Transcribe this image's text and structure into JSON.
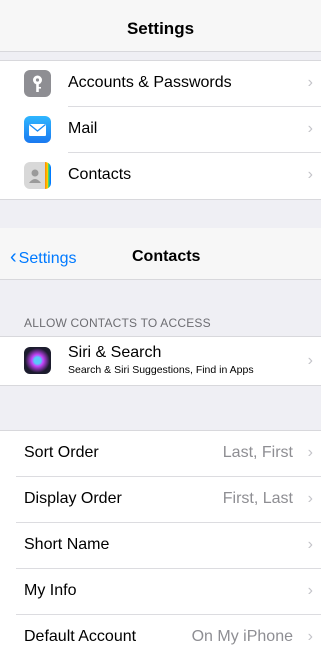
{
  "top_nav": {
    "title": "Settings"
  },
  "settings_items": [
    {
      "label": "Accounts & Passwords",
      "icon": "key-icon"
    },
    {
      "label": "Mail",
      "icon": "mail-icon"
    },
    {
      "label": "Contacts",
      "icon": "contacts-icon"
    }
  ],
  "contacts_nav": {
    "back_label": "Settings",
    "title": "Contacts"
  },
  "access_section": {
    "header": "ALLOW CONTACTS TO ACCESS",
    "siri": {
      "title": "Siri & Search",
      "subtitle": "Search & Siri Suggestions, Find in Apps",
      "icon": "siri-icon"
    }
  },
  "prefs": [
    {
      "label": "Sort Order",
      "value": "Last, First"
    },
    {
      "label": "Display Order",
      "value": "First, Last"
    },
    {
      "label": "Short Name",
      "value": ""
    },
    {
      "label": "My Info",
      "value": ""
    },
    {
      "label": "Default Account",
      "value": "On My iPhone"
    }
  ]
}
